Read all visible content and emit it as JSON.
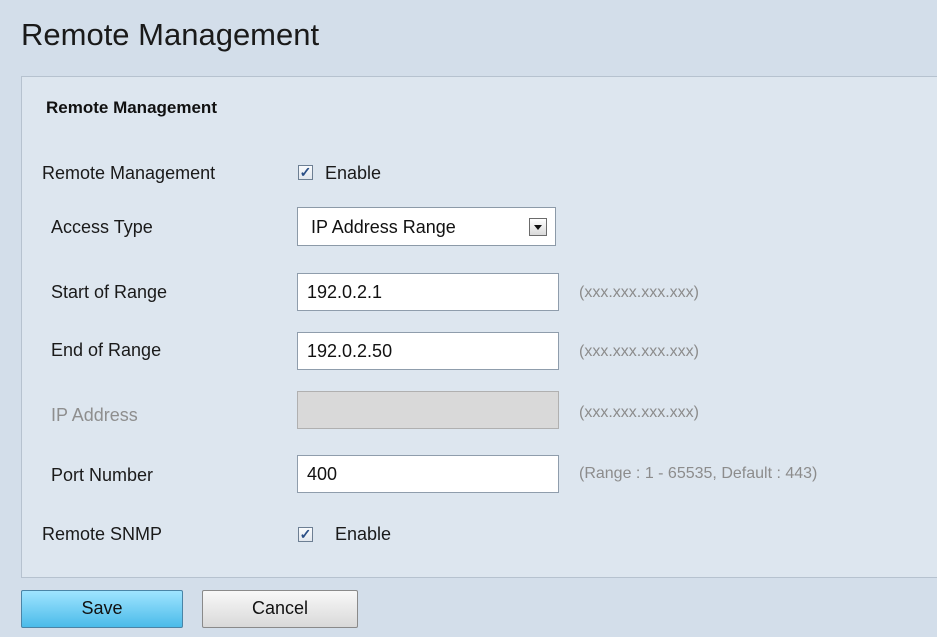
{
  "page": {
    "title": "Remote Management"
  },
  "section": {
    "title": "Remote Management"
  },
  "remote_management": {
    "label": "Remote Management",
    "checkbox_label": "Enable",
    "checked": true
  },
  "access_type": {
    "label": "Access Type",
    "selected": "IP Address Range"
  },
  "start_of_range": {
    "label": "Start of Range",
    "value": "192.0.2.1",
    "hint": "(xxx.xxx.xxx.xxx)"
  },
  "end_of_range": {
    "label": "End of Range",
    "value": "192.0.2.50",
    "hint": "(xxx.xxx.xxx.xxx)"
  },
  "ip_address": {
    "label": "IP Address",
    "value": "",
    "hint": "(xxx.xxx.xxx.xxx)",
    "disabled": true
  },
  "port_number": {
    "label": "Port Number",
    "value": "400",
    "hint": "(Range : 1 - 65535, Default : 443)"
  },
  "remote_snmp": {
    "label": "Remote SNMP",
    "checkbox_label": "Enable",
    "checked": true
  },
  "buttons": {
    "save": "Save",
    "cancel": "Cancel"
  },
  "icons": {
    "checkbox_check": "checkmark-icon",
    "dropdown": "chevron-down-icon"
  },
  "colors": {
    "background": "#d3deea",
    "save_button": "#4bbbe9",
    "hint_text": "#8c8c8c"
  }
}
